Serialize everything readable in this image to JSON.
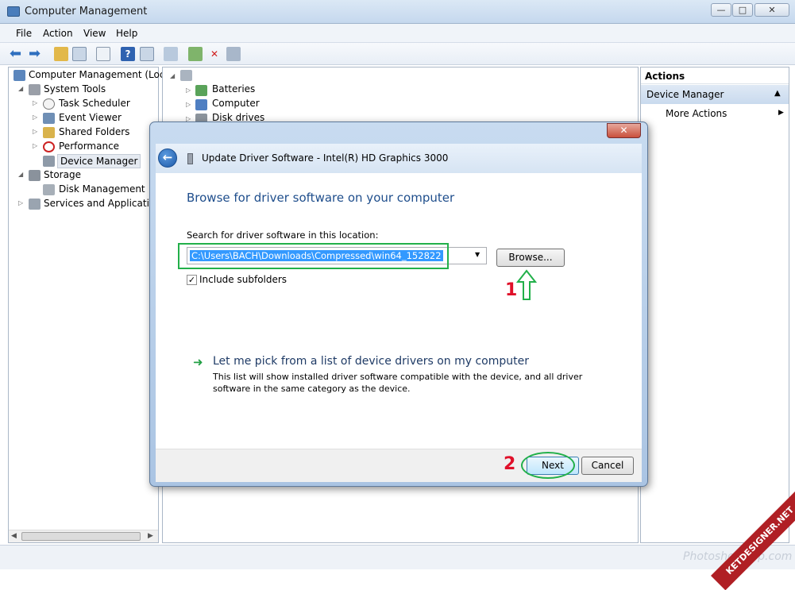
{
  "window": {
    "title": "Computer Management",
    "minimize": "—",
    "maximize": "□",
    "close": "✕"
  },
  "menu": [
    "File",
    "Action",
    "View",
    "Help"
  ],
  "tree": {
    "root": "Computer Management (Local",
    "system_tools": "System Tools",
    "task_scheduler": "Task Scheduler",
    "event_viewer": "Event Viewer",
    "shared_folders": "Shared Folders",
    "performance": "Performance",
    "device_manager": "Device Manager",
    "storage": "Storage",
    "disk_management": "Disk Management",
    "services": "Services and Applications"
  },
  "devices": [
    "Batteries",
    "Computer",
    "Disk drives"
  ],
  "actions": {
    "header": "Actions",
    "section": "Device Manager",
    "more": "More Actions"
  },
  "dialog": {
    "header_title": "Update Driver Software - Intel(R) HD Graphics 3000",
    "heading": "Browse for driver software on your computer",
    "search_label": "Search for driver software in this location:",
    "path_value": "C:\\Users\\BACH\\Downloads\\Compressed\\win64_152822",
    "browse_label": "Browse...",
    "include_subfolders": "Include subfolders",
    "pick_title": "Let me pick from a list of device drivers on my computer",
    "pick_desc_1": "This list will show installed driver software compatible with the device, and all driver",
    "pick_desc_2": "software in the same category as the device.",
    "next_label": "Next",
    "cancel_label": "Cancel",
    "step_1": "1",
    "step_2": "2"
  },
  "watermark": {
    "left": "Photoshop",
    "right": "sup.com",
    "badge": "KETDESIGNER.NET"
  },
  "colors": {
    "heading_blue": "#1f4e8c",
    "highlight_green": "#22b04a",
    "step_red": "#e0102a"
  }
}
